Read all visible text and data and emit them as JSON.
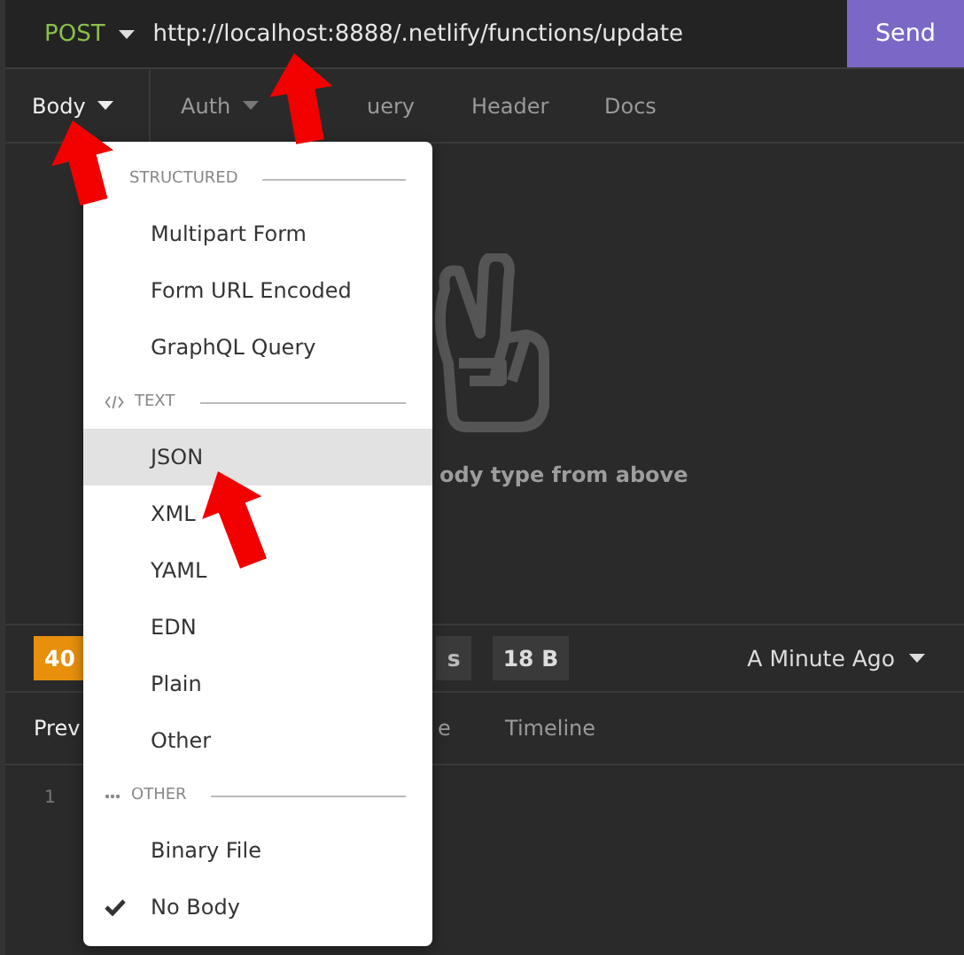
{
  "request": {
    "method": "POST",
    "url": "http://localhost:8888/.netlify/functions/update",
    "send": "Send"
  },
  "request_tabs": [
    {
      "label": "Body",
      "selected": true,
      "caret": true
    },
    {
      "label": "Auth",
      "selected": false,
      "caret": true
    },
    {
      "label": "uery",
      "selected": false,
      "caret": false
    },
    {
      "label": "Header",
      "selected": false,
      "caret": false
    },
    {
      "label": "Docs",
      "selected": false,
      "caret": false
    }
  ],
  "empty_state": {
    "text": "ody type from above"
  },
  "body_menu": {
    "sections": [
      {
        "header": "STRUCTURED",
        "items": [
          {
            "label": "Multipart Form",
            "selected": false,
            "checked": false
          },
          {
            "label": "Form URL Encoded",
            "selected": false,
            "checked": false
          },
          {
            "label": "GraphQL Query",
            "selected": false,
            "checked": false
          }
        ]
      },
      {
        "header": "TEXT",
        "items": [
          {
            "label": "JSON",
            "selected": true,
            "checked": false
          },
          {
            "label": "XML",
            "selected": false,
            "checked": false
          },
          {
            "label": "YAML",
            "selected": false,
            "checked": false
          },
          {
            "label": "EDN",
            "selected": false,
            "checked": false
          },
          {
            "label": "Plain",
            "selected": false,
            "checked": false
          },
          {
            "label": "Other",
            "selected": false,
            "checked": false
          }
        ]
      },
      {
        "header": "OTHER",
        "items": [
          {
            "label": "Binary File",
            "selected": false,
            "checked": false
          },
          {
            "label": "No Body",
            "selected": false,
            "checked": true
          }
        ]
      }
    ]
  },
  "response": {
    "status": "40",
    "time": "s",
    "size": "18 B",
    "history": "A Minute Ago"
  },
  "response_tabs": [
    {
      "label": "Prev",
      "selected": true
    },
    {
      "label": "e",
      "selected": false
    },
    {
      "label": "Timeline",
      "selected": false
    }
  ],
  "line_numbers": [
    "1"
  ]
}
